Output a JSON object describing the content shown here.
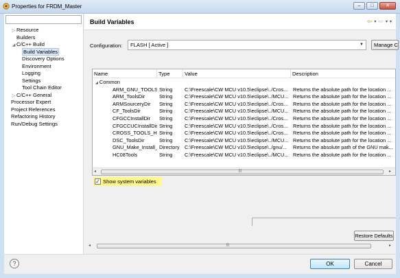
{
  "window": {
    "title": "Properties for FRDM_Master",
    "minimize_glyph": "–",
    "maximize_glyph": "□",
    "close_glyph": "✕"
  },
  "filter": {
    "value": ""
  },
  "tree": [
    {
      "label": "Resource",
      "twisty": "▷",
      "indent": 1,
      "selected": false
    },
    {
      "label": "Builders",
      "twisty": "",
      "indent": 1,
      "selected": false
    },
    {
      "label": "C/C++ Build",
      "twisty": "◢",
      "indent": 1,
      "selected": false
    },
    {
      "label": "Build Variables",
      "twisty": "",
      "indent": 2,
      "selected": true
    },
    {
      "label": "Discovery Options",
      "twisty": "",
      "indent": 2,
      "selected": false
    },
    {
      "label": "Environment",
      "twisty": "",
      "indent": 2,
      "selected": false
    },
    {
      "label": "Logging",
      "twisty": "",
      "indent": 2,
      "selected": false
    },
    {
      "label": "Settings",
      "twisty": "",
      "indent": 2,
      "selected": false
    },
    {
      "label": "Tool Chain Editor",
      "twisty": "",
      "indent": 2,
      "selected": false
    },
    {
      "label": "C/C++ General",
      "twisty": "▷",
      "indent": 1,
      "selected": false
    },
    {
      "label": "Processor Expert",
      "twisty": "",
      "indent": 0,
      "selected": false
    },
    {
      "label": "Project References",
      "twisty": "",
      "indent": 0,
      "selected": false
    },
    {
      "label": "Refactoring History",
      "twisty": "",
      "indent": 0,
      "selected": false
    },
    {
      "label": "Run/Debug Settings",
      "twisty": "",
      "indent": 0,
      "selected": false
    }
  ],
  "page": {
    "title": "Build Variables",
    "back_glyph": "⇦",
    "forward_glyph": "⇨",
    "menu_glyph": "▾"
  },
  "configuration": {
    "label": "Configuration:",
    "value": "FLASH  [ Active ]",
    "manage_label": "Manage C"
  },
  "table": {
    "columns": [
      "Name",
      "Type",
      "Value",
      "Description"
    ],
    "group": {
      "twisty": "◢",
      "label": "Common"
    },
    "rows": [
      {
        "name": "ARM_GNU_TOOLS_H",
        "type": "String",
        "value": "C:\\Freescale\\CW MCU v10.5\\eclipse\\../Cros...",
        "description": "Returns the absolute path for the location ..."
      },
      {
        "name": "ARM_ToolsDir",
        "type": "String",
        "value": "C:\\Freescale\\CW MCU v10.5\\eclipse\\../MCU...",
        "description": "Returns the absolute path for the location ..."
      },
      {
        "name": "ARMSourceryDir",
        "type": "String",
        "value": "C:\\Freescale\\CW MCU v10.5\\eclipse\\../Cros...",
        "description": "Returns the absolute path for the location ..."
      },
      {
        "name": "CF_ToolsDir",
        "type": "String",
        "value": "C:\\Freescale\\CW MCU v10.5\\eclipse\\../MCU...",
        "description": "Returns the absolute path for the location ..."
      },
      {
        "name": "CFGCCInstallDir",
        "type": "String",
        "value": "C:\\Freescale\\CW MCU v10.5\\eclipse\\../Cros...",
        "description": "Returns the absolute path for the location ..."
      },
      {
        "name": "CFGCCUCInstallDir",
        "type": "String",
        "value": "C:\\Freescale\\CW MCU v10.5\\eclipse\\../Cros...",
        "description": "Returns the absolute path for the location ..."
      },
      {
        "name": "CROSS_TOOLS_HOM",
        "type": "String",
        "value": "C:\\Freescale\\CW MCU v10.5\\eclipse\\../Cros...",
        "description": "Returns the absolute path for the location ..."
      },
      {
        "name": "DSC_ToolsDir",
        "type": "String",
        "value": "C:\\Freescale\\CW MCU v10.5\\eclipse\\../MCU...",
        "description": "Returns the absolute path for the location ..."
      },
      {
        "name": "GNU_Make_Install_D",
        "type": "Directory",
        "value": "C:\\Freescale\\CW MCU v10.5\\eclipse\\../gnu/...",
        "description": "Returns the absolute path of the GNU mak..."
      },
      {
        "name": "HC08Tools",
        "type": "String",
        "value": "C:\\Freescale\\CW MCU v10.5\\eclipse\\../MCU...",
        "description": "Returns the absolute path for the location ..."
      }
    ]
  },
  "show_system_variables": {
    "label": "Show system variables",
    "checked": true,
    "check_glyph": "✓"
  },
  "restore_defaults_label": "Restore Defaults",
  "footer": {
    "help_glyph": "?",
    "ok_label": "OK",
    "cancel_label": "Cancel"
  },
  "scroll": {
    "left_glyph": "◂",
    "right_glyph": "▸",
    "grip_glyph": "|||"
  },
  "colors": {
    "accent_highlight": "#fff78c",
    "selection": "#dbe7f7",
    "nav_arrow": "#c89a2c"
  }
}
